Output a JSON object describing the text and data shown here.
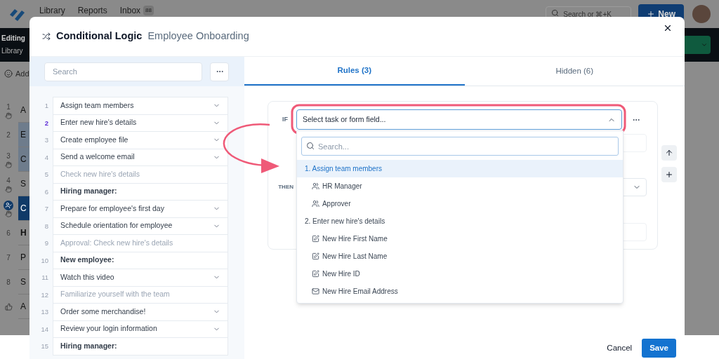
{
  "top_nav": {
    "links": [
      {
        "label": "Library"
      },
      {
        "label": "Reports"
      },
      {
        "label": "Inbox",
        "badge": "88"
      }
    ],
    "search": {
      "placeholder": "Search or ⌘+K"
    },
    "new_button": "New"
  },
  "edit_bar": {
    "title": "Editing",
    "subtitle": "Library"
  },
  "add_row": {
    "label": "Add"
  },
  "background_steps": [
    {
      "number": "1",
      "label": "A",
      "kind": "task",
      "highlighted": false
    },
    {
      "number": "2",
      "label": "E",
      "kind": "plain",
      "highlighted": true
    },
    {
      "number": "3",
      "label": "C",
      "kind": "task",
      "highlighted": true
    },
    {
      "number": "4",
      "label": "S",
      "kind": "task",
      "highlighted": false
    },
    {
      "label": "C",
      "kind": "current",
      "highlighted": true
    },
    {
      "number": "6",
      "label": "H",
      "kind": "heading",
      "highlighted": false
    },
    {
      "number": "7",
      "label": "P",
      "kind": "plain",
      "highlighted": false
    },
    {
      "number": "8",
      "label": "S",
      "kind": "plain",
      "highlighted": false
    },
    {
      "label": "A",
      "kind": "approval",
      "highlighted": false
    }
  ],
  "modal": {
    "title": "Conditional Logic",
    "subtitle": "Employee Onboarding",
    "search": {
      "placeholder": "Search"
    },
    "steps": [
      {
        "number": "1",
        "label": "Assign team members",
        "kind": "task",
        "selected": false
      },
      {
        "number": "2",
        "label": "Enter new hire's details",
        "kind": "task",
        "selected": true
      },
      {
        "number": "3",
        "label": "Create employee file",
        "kind": "task",
        "selected": false
      },
      {
        "number": "4",
        "label": "Send a welcome email",
        "kind": "task",
        "selected": false
      },
      {
        "number": "5",
        "label": "Check new hire's details",
        "kind": "hidden",
        "selected": false
      },
      {
        "number": "6",
        "label": "Hiring manager:",
        "kind": "heading",
        "selected": false
      },
      {
        "number": "7",
        "label": "Prepare for employee's first day",
        "kind": "task",
        "selected": false
      },
      {
        "number": "8",
        "label": "Schedule orientation for employee",
        "kind": "task",
        "selected": false
      },
      {
        "number": "9",
        "label": "Approval: Check new hire's details",
        "kind": "hidden",
        "selected": false
      },
      {
        "number": "10",
        "label": "New employee:",
        "kind": "heading",
        "selected": false
      },
      {
        "number": "11",
        "label": "Watch this video",
        "kind": "task",
        "selected": false
      },
      {
        "number": "12",
        "label": "Familiarize yourself with the team",
        "kind": "hidden",
        "selected": false
      },
      {
        "number": "13",
        "label": "Order some merchandise!",
        "kind": "task",
        "selected": false
      },
      {
        "number": "14",
        "label": "Review your login information",
        "kind": "task",
        "selected": false
      },
      {
        "number": "15",
        "label": "Hiring manager:",
        "kind": "heading",
        "selected": false
      }
    ],
    "tabs": [
      {
        "label": "Rules (3)",
        "selected": true
      },
      {
        "label": "Hidden (6)",
        "selected": false
      }
    ],
    "rule": {
      "if_label": "IF",
      "then_label": "THEN",
      "select": {
        "placeholder": "Select task or form field...",
        "expanded": true
      },
      "dropdown": {
        "search": {
          "placeholder": "Search..."
        },
        "options": [
          {
            "label": "1. Assign team members",
            "kind": "group",
            "selected": true
          },
          {
            "label": "HR Manager",
            "kind": "role",
            "selected": false
          },
          {
            "label": "Approver",
            "kind": "role",
            "selected": false
          },
          {
            "label": "2. Enter new hire's details",
            "kind": "group",
            "selected": false
          },
          {
            "label": "New Hire First Name",
            "kind": "field",
            "selected": false
          },
          {
            "label": "New Hire Last Name",
            "kind": "field",
            "selected": false
          },
          {
            "label": "New Hire ID",
            "kind": "field",
            "selected": false
          },
          {
            "label": "New Hire Email Address",
            "kind": "email",
            "selected": false
          }
        ]
      }
    },
    "footer": {
      "cancel": "Cancel",
      "save": "Save"
    }
  }
}
